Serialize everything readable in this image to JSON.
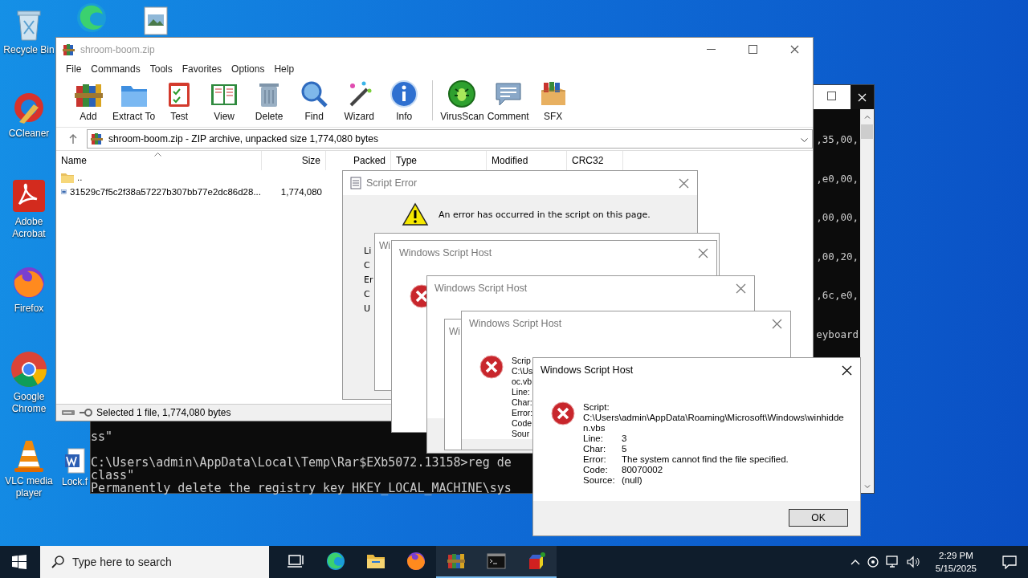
{
  "desktop": {
    "icons": [
      {
        "kind": "recycle",
        "label": "Recycle Bin"
      },
      {
        "kind": "edge"
      },
      {
        "kind": "image"
      },
      {
        "kind": "ccleaner",
        "label": "CCleaner"
      },
      {
        "kind": "acrobat",
        "label": "Adobe Acrobat"
      },
      {
        "kind": "firefox",
        "label": "Firefox"
      },
      {
        "kind": "chrome",
        "label": "Google Chrome"
      },
      {
        "kind": "vlc",
        "label": "VLC media player"
      },
      {
        "kind": "word",
        "label": "Lock.f"
      }
    ]
  },
  "console": {
    "fragments": [
      ",35,00,",
      ",e0,00,",
      ",00,00,",
      ",00,20,",
      ",6c,e0,",
      "eyboard"
    ],
    "lines": [
      {
        "text": "ss\""
      },
      {
        "text": "C:\\Users\\admin\\AppData\\Local\\Temp\\Rar$EXb5072.13158>reg de",
        "blank_before": true
      },
      {
        "text": "class\""
      },
      {
        "text": "Permanently delete the registry key HKEY_LOCAL_MACHINE\\sys"
      }
    ]
  },
  "archiver": {
    "title": "shroom-boom.zip",
    "menu": [
      "File",
      "Commands",
      "Tools",
      "Favorites",
      "Options",
      "Help"
    ],
    "toolbar": [
      {
        "kind": "add",
        "label": "Add"
      },
      {
        "kind": "extract",
        "label": "Extract To"
      },
      {
        "kind": "test",
        "label": "Test"
      },
      {
        "kind": "view",
        "label": "View"
      },
      {
        "kind": "delete",
        "label": "Delete"
      },
      {
        "kind": "find",
        "label": "Find"
      },
      {
        "kind": "wizard",
        "label": "Wizard"
      },
      {
        "kind": "info",
        "label": "Info",
        "separator_after": true
      },
      {
        "kind": "virusscan",
        "label": "VirusScan"
      },
      {
        "kind": "comment",
        "label": "Comment"
      },
      {
        "kind": "sfx",
        "label": "SFX"
      }
    ],
    "address": "shroom-boom.zip - ZIP archive, unpacked size 1,774,080 bytes",
    "table": {
      "columns": [
        {
          "label": "Name",
          "sorted": true
        },
        {
          "label": "Size"
        },
        {
          "label": "Packed"
        },
        {
          "label": "Type"
        },
        {
          "label": "Modified"
        },
        {
          "label": "CRC32"
        }
      ],
      "rows": [
        {
          "kind": "folder",
          "name": ".."
        },
        {
          "kind": "file",
          "name": "31529c7f5c2f38a57227b307bb77e2dc86d28...",
          "size": "1,774,080"
        }
      ]
    },
    "status_bar": "Selected 1 file, 1,774,080 bytes"
  },
  "dialogs": [
    {
      "kind": "script_error",
      "title": "Script Error",
      "close": true,
      "message": "An error has occurred in the script on this page.",
      "lines": [
        "Li",
        "C",
        "Er",
        "C",
        "U"
      ]
    },
    {
      "kind": "wsh",
      "title": "Wi",
      "active": false
    },
    {
      "kind": "wsh",
      "title": "Windows Script Host",
      "active": false,
      "close": true
    },
    {
      "kind": "wsh",
      "title": "Windows Script Host",
      "active": false,
      "close": true,
      "footer": true
    },
    {
      "kind": "wsh",
      "title": "Wi",
      "active": false
    },
    {
      "kind": "wsh",
      "title": "Windows Script Host",
      "active": false,
      "close": true,
      "lines": [
        "Scrip",
        "C:\\Us",
        "oc.vb",
        "Line:",
        "Char:",
        "Error:",
        "Code",
        "Sour"
      ],
      "footer": true
    },
    {
      "kind": "wsh",
      "title": "Windows Script Host",
      "active": true,
      "close": true,
      "script_label": "Script:",
      "script_path": "C:\\Users\\admin\\AppData\\Roaming\\Microsoft\\Windows\\winhidden.vbs",
      "fields": [
        {
          "label": "Line:",
          "value": "3"
        },
        {
          "label": "Char:",
          "value": "5"
        },
        {
          "label": "Error:",
          "value": "The system cannot find the file specified."
        },
        {
          "label": "Code:",
          "value": "80070002"
        },
        {
          "label": "Source:",
          "value": "(null)"
        }
      ],
      "footer": true,
      "button": "OK"
    }
  ],
  "taskbar": {
    "search": {
      "placeholder": "Type here to search"
    },
    "apps": [
      {
        "kind": "taskview",
        "running": false
      },
      {
        "kind": "edge",
        "running": false
      },
      {
        "kind": "explorer",
        "running": false
      },
      {
        "kind": "firefox",
        "running": false
      },
      {
        "kind": "winrar",
        "running": true
      },
      {
        "kind": "cmd",
        "running": true
      },
      {
        "kind": "app",
        "running": true
      }
    ],
    "time": "2:29 PM",
    "date": "5/15/2025"
  }
}
